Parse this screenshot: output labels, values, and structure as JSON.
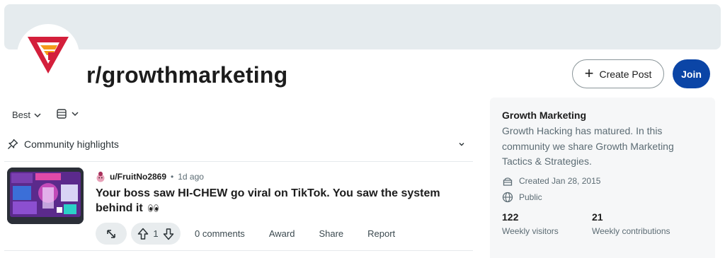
{
  "subreddit": {
    "name": "r/growthmarketing",
    "logo_icon": "growth-logo"
  },
  "header": {
    "create_post_label": "Create Post",
    "join_label": "Join"
  },
  "feed": {
    "sort_label": "Best",
    "view_icon": "card-view-icon",
    "highlights_label": "Community highlights"
  },
  "post": {
    "username": "u/FruitNo2869",
    "separator": "•",
    "time": "1d ago",
    "title": "Your boss saw HI-CHEW go viral on TikTok. You saw the system behind it",
    "vote_count": "1",
    "comments_label": "0 comments",
    "award_label": "Award",
    "share_label": "Share",
    "report_label": "Report"
  },
  "sidebar": {
    "title": "Growth Marketing",
    "description": "Growth Hacking has matured. In this community we share Growth Marketing Tactics & Strategies.",
    "created": "Created Jan 28, 2015",
    "visibility": "Public",
    "stats": [
      {
        "value": "122",
        "label": "Weekly visitors"
      },
      {
        "value": "21",
        "label": "Weekly contributions"
      }
    ]
  },
  "colors": {
    "accent": "#0b45a6",
    "logo_red": "#d41f3b",
    "logo_orange": "#f59a1a",
    "banner": "#e5ebee"
  }
}
